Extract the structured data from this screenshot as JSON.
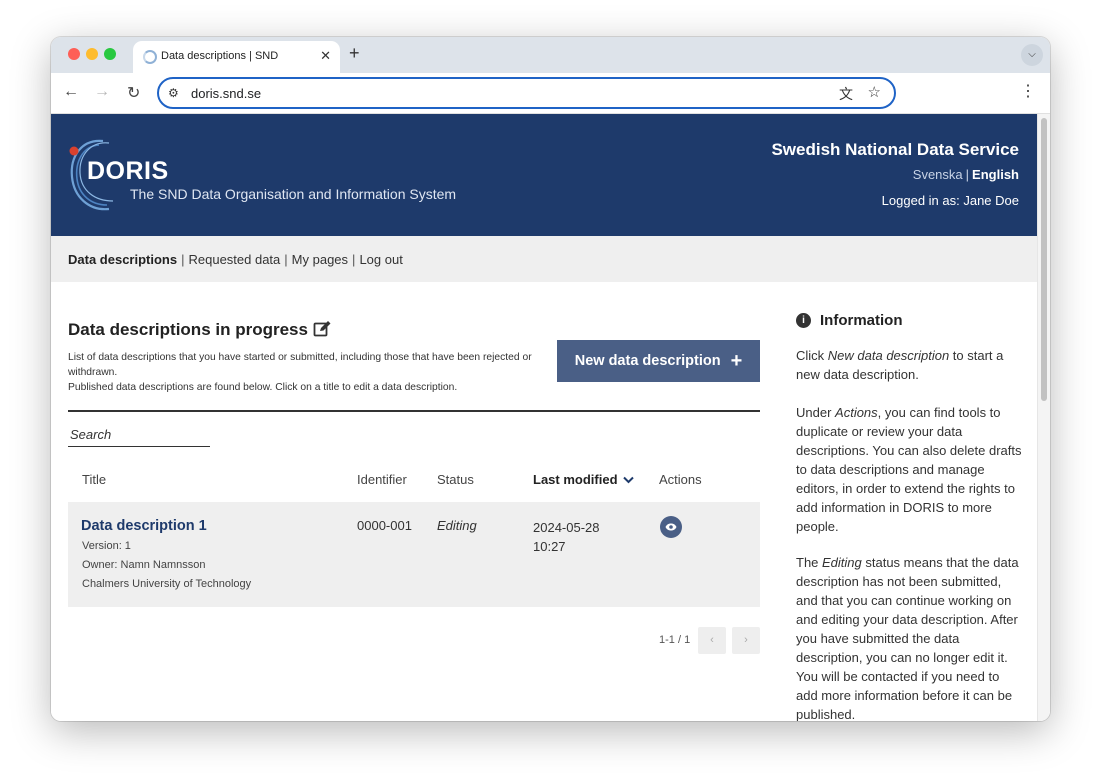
{
  "browser": {
    "tab_title": "Data descriptions | SND",
    "tab_close": "✕",
    "new_tab": "+",
    "url": "doris.snd.se"
  },
  "header": {
    "logo_name": "DORIS",
    "logo_subtitle": "The SND Data Organisation and Information System",
    "org_name": "Swedish National Data Service",
    "lang_svenska": "Svenska",
    "lang_separator": "|",
    "lang_english": "English",
    "logged_in": "Logged in as: Jane Doe"
  },
  "subnav": {
    "items": [
      "Data descriptions",
      "Requested data",
      "My pages",
      "Log out"
    ],
    "separator": "|"
  },
  "main": {
    "title": "Data descriptions in progress",
    "desc_line1": "List of data descriptions that you have started or submitted, including those that have been rejected or withdrawn.",
    "desc_line2": "Published data descriptions are found below. Click on a title to edit a data description.",
    "new_button": "New data description",
    "search_placeholder": "Search",
    "columns": {
      "title": "Title",
      "identifier": "Identifier",
      "status": "Status",
      "last_modified": "Last modified",
      "actions": "Actions"
    },
    "rows": [
      {
        "title": "Data description 1",
        "version": "Version: 1",
        "owner": "Owner: Namn Namnsson",
        "organisation": "Chalmers University of Technology",
        "identifier": "0000-001",
        "status": "Editing",
        "date": "2024-05-28",
        "time": "10:27"
      }
    ],
    "pagination": {
      "count": "1-1 / 1",
      "prev": "‹",
      "next": "›"
    }
  },
  "info": {
    "heading": "Information",
    "p1_a": "Click ",
    "p1_em": "New data description",
    "p1_b": " to start a new data description.",
    "p2_a": "Under ",
    "p2_em": "Actions",
    "p2_b": ", you can find tools to duplicate or review your data descriptions. You can also delete drafts to data descriptions and manage editors, in order to extend the rights to add information in DORIS to more people.",
    "p3_a": "The ",
    "p3_em": "Editing",
    "p3_b": " status means that the data description has not been submitted, and that you can continue working on and editing your data description. After you have submitted the data description, you can no longer edit it. You will be contacted if you need to add more information before it can be published."
  },
  "colors": {
    "header_bg": "#1e3a6b",
    "button_bg": "#4a5f86",
    "accent_red": "#d9412e",
    "omnibox_border": "#1f63c6"
  },
  "icons": {
    "edit": "edit-icon",
    "plus": "plus-icon",
    "sort": "chevron-down-icon",
    "view": "eye-icon",
    "info": "info-icon"
  }
}
